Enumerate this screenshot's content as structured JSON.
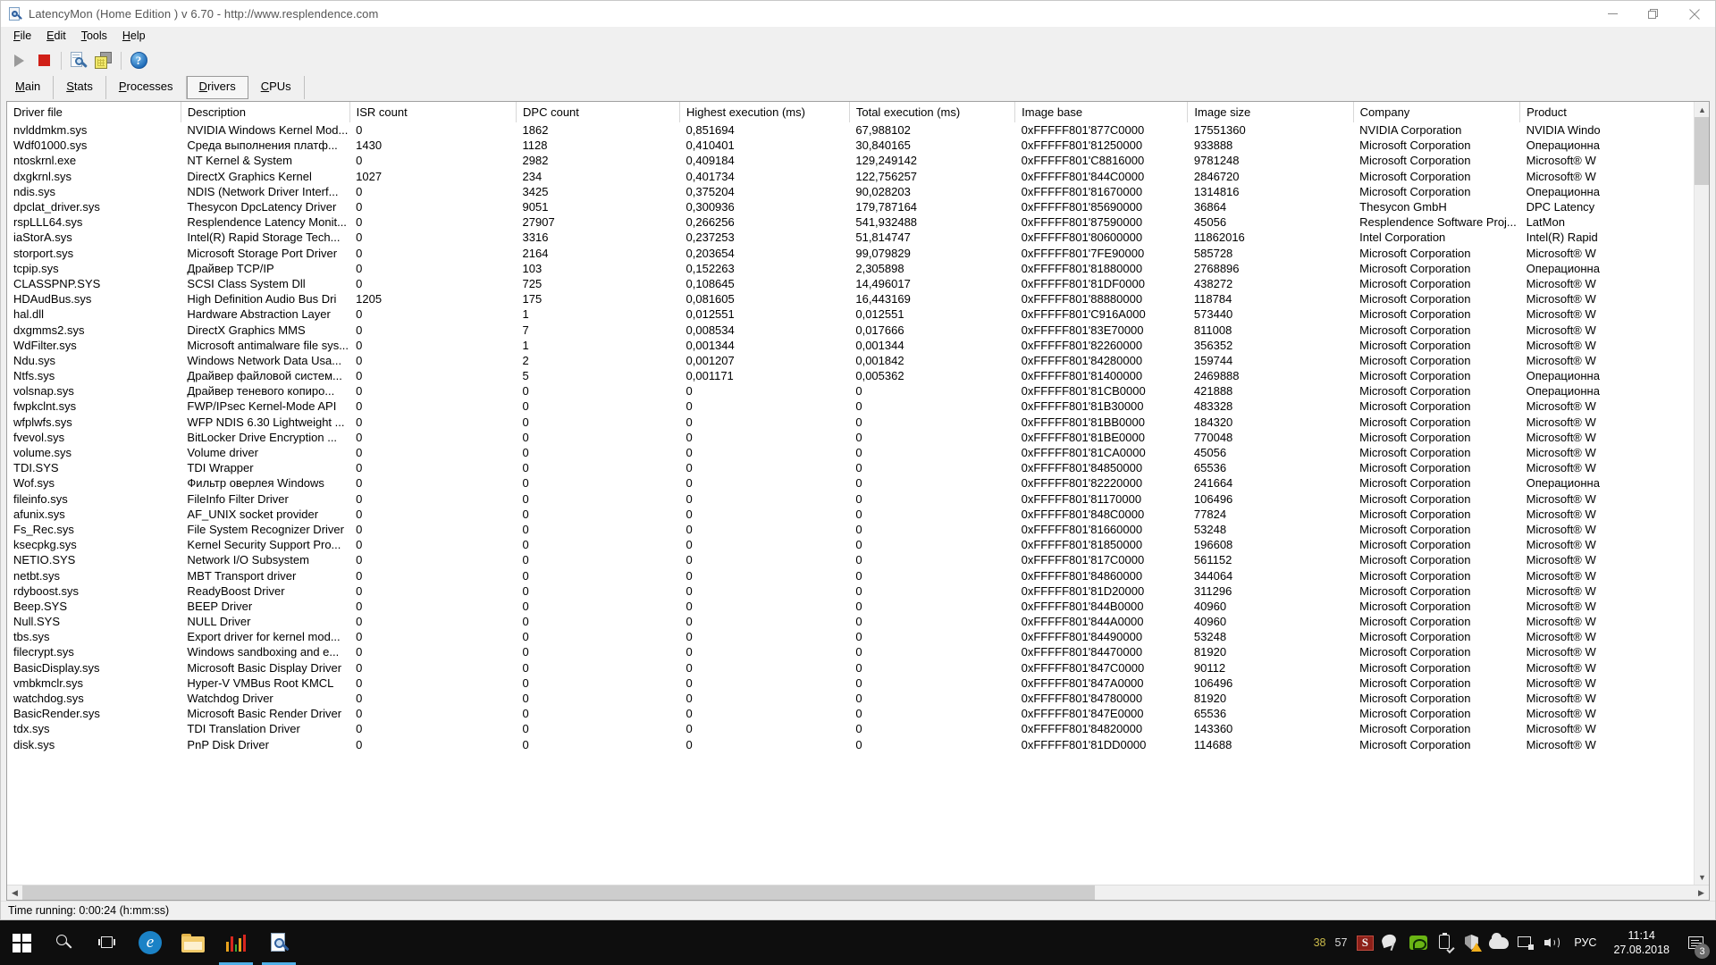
{
  "window": {
    "title": "LatencyMon  (Home Edition )  v 6.70 - http://www.resplendence.com",
    "icon": "latencymon-icon",
    "minimize": "minimize-icon",
    "maximize": "restore-icon",
    "close": "close-icon"
  },
  "menu": [
    {
      "label": "File",
      "accel": "F"
    },
    {
      "label": "Edit",
      "accel": "E"
    },
    {
      "label": "Tools",
      "accel": "T"
    },
    {
      "label": "Help",
      "accel": "H"
    }
  ],
  "toolbar": {
    "start_label": "start-monitoring",
    "stop_label": "stop-monitoring",
    "report_label": "view-report",
    "copy_label": "copy-to-clipboard",
    "help_label": "?"
  },
  "tabs": [
    {
      "label": "Main",
      "accel": "M",
      "active": false
    },
    {
      "label": "Stats",
      "accel": "S",
      "active": false
    },
    {
      "label": "Processes",
      "accel": "P",
      "active": false
    },
    {
      "label": "Drivers",
      "accel": "D",
      "active": true
    },
    {
      "label": "CPUs",
      "accel": "C",
      "active": false
    }
  ],
  "grid": {
    "columns": [
      "Driver file",
      "Description",
      "ISR count",
      "DPC count",
      "Highest execution (ms)",
      "Total execution (ms)",
      "Image base",
      "Image size",
      "Company",
      "Product"
    ],
    "rows": [
      [
        "nvlddmkm.sys",
        "NVIDIA Windows Kernel Mod...",
        "0",
        "1862",
        "0,851694",
        "67,988102",
        "0xFFFFF801'877C0000",
        "17551360",
        "NVIDIA Corporation",
        "NVIDIA Windo"
      ],
      [
        "Wdf01000.sys",
        "Среда выполнения платф...",
        "1430",
        "1128",
        "0,410401",
        "30,840165",
        "0xFFFFF801'81250000",
        "933888",
        "Microsoft Corporation",
        "Операционна"
      ],
      [
        "ntoskrnl.exe",
        "NT Kernel & System",
        "0",
        "2982",
        "0,409184",
        "129,249142",
        "0xFFFFF801'C8816000",
        "9781248",
        "Microsoft Corporation",
        "Microsoft® W"
      ],
      [
        "dxgkrnl.sys",
        "DirectX Graphics Kernel",
        "1027",
        "234",
        "0,401734",
        "122,756257",
        "0xFFFFF801'844C0000",
        "2846720",
        "Microsoft Corporation",
        "Microsoft® W"
      ],
      [
        "ndis.sys",
        "NDIS (Network Driver Interf...",
        "0",
        "3425",
        "0,375204",
        "90,028203",
        "0xFFFFF801'81670000",
        "1314816",
        "Microsoft Corporation",
        "Операционна"
      ],
      [
        "dpclat_driver.sys",
        "Thesycon DpcLatency Driver",
        "0",
        "9051",
        "0,300936",
        "179,787164",
        "0xFFFFF801'85690000",
        "36864",
        "Thesycon GmbH",
        "DPC Latency "
      ],
      [
        "rspLLL64.sys",
        "Resplendence Latency Monit...",
        "0",
        "27907",
        "0,266256",
        "541,932488",
        "0xFFFFF801'87590000",
        "45056",
        "Resplendence Software Proj...",
        "LatMon"
      ],
      [
        "iaStorA.sys",
        "Intel(R) Rapid Storage Tech...",
        "0",
        "3316",
        "0,237253",
        "51,814747",
        "0xFFFFF801'80600000",
        "11862016",
        "Intel Corporation",
        "Intel(R) Rapid"
      ],
      [
        "storport.sys",
        "Microsoft Storage Port Driver",
        "0",
        "2164",
        "0,203654",
        "99,079829",
        "0xFFFFF801'7FE90000",
        "585728",
        "Microsoft Corporation",
        "Microsoft® W"
      ],
      [
        "tcpip.sys",
        "Драйвер TCP/IP",
        "0",
        "103",
        "0,152263",
        "2,305898",
        "0xFFFFF801'81880000",
        "2768896",
        "Microsoft Corporation",
        "Операционна"
      ],
      [
        "CLASSPNP.SYS",
        "SCSI Class System Dll",
        "0",
        "725",
        "0,108645",
        "14,496017",
        "0xFFFFF801'81DF0000",
        "438272",
        "Microsoft Corporation",
        "Microsoft® W"
      ],
      [
        "HDAudBus.sys",
        "High Definition Audio Bus Dri",
        "1205",
        "175",
        "0,081605",
        "16,443169",
        "0xFFFFF801'88880000",
        "118784",
        "Microsoft Corporation",
        "Microsoft® W"
      ],
      [
        "hal.dll",
        "Hardware Abstraction Layer",
        "0",
        "1",
        "0,012551",
        "0,012551",
        "0xFFFFF801'C916A000",
        "573440",
        "Microsoft Corporation",
        "Microsoft® W"
      ],
      [
        "dxgmms2.sys",
        "DirectX Graphics MMS",
        "0",
        "7",
        "0,008534",
        "0,017666",
        "0xFFFFF801'83E70000",
        "811008",
        "Microsoft Corporation",
        "Microsoft® W"
      ],
      [
        "WdFilter.sys",
        "Microsoft antimalware file sys...",
        "0",
        "1",
        "0,001344",
        "0,001344",
        "0xFFFFF801'82260000",
        "356352",
        "Microsoft Corporation",
        "Microsoft® W"
      ],
      [
        "Ndu.sys",
        "Windows Network Data Usa...",
        "0",
        "2",
        "0,001207",
        "0,001842",
        "0xFFFFF801'84280000",
        "159744",
        "Microsoft Corporation",
        "Microsoft® W"
      ],
      [
        "Ntfs.sys",
        "Драйвер файловой систем...",
        "0",
        "5",
        "0,001171",
        "0,005362",
        "0xFFFFF801'81400000",
        "2469888",
        "Microsoft Corporation",
        "Операционна"
      ],
      [
        "volsnap.sys",
        "Драйвер теневого копиро...",
        "0",
        "0",
        "0",
        "0",
        "0xFFFFF801'81CB0000",
        "421888",
        "Microsoft Corporation",
        "Операционна"
      ],
      [
        "fwpkclnt.sys",
        "FWP/IPsec Kernel-Mode API",
        "0",
        "0",
        "0",
        "0",
        "0xFFFFF801'81B30000",
        "483328",
        "Microsoft Corporation",
        "Microsoft® W"
      ],
      [
        "wfplwfs.sys",
        "WFP NDIS 6.30 Lightweight ...",
        "0",
        "0",
        "0",
        "0",
        "0xFFFFF801'81BB0000",
        "184320",
        "Microsoft Corporation",
        "Microsoft® W"
      ],
      [
        "fvevol.sys",
        "BitLocker Drive Encryption ...",
        "0",
        "0",
        "0",
        "0",
        "0xFFFFF801'81BE0000",
        "770048",
        "Microsoft Corporation",
        "Microsoft® W"
      ],
      [
        "volume.sys",
        "Volume driver",
        "0",
        "0",
        "0",
        "0",
        "0xFFFFF801'81CA0000",
        "45056",
        "Microsoft Corporation",
        "Microsoft® W"
      ],
      [
        "TDI.SYS",
        "TDI Wrapper",
        "0",
        "0",
        "0",
        "0",
        "0xFFFFF801'84850000",
        "65536",
        "Microsoft Corporation",
        "Microsoft® W"
      ],
      [
        "Wof.sys",
        "Фильтр оверлея Windows",
        "0",
        "0",
        "0",
        "0",
        "0xFFFFF801'82220000",
        "241664",
        "Microsoft Corporation",
        "Операционна"
      ],
      [
        "fileinfo.sys",
        "FileInfo Filter Driver",
        "0",
        "0",
        "0",
        "0",
        "0xFFFFF801'81170000",
        "106496",
        "Microsoft Corporation",
        "Microsoft® W"
      ],
      [
        "afunix.sys",
        "AF_UNIX socket provider",
        "0",
        "0",
        "0",
        "0",
        "0xFFFFF801'848C0000",
        "77824",
        "Microsoft Corporation",
        "Microsoft® W"
      ],
      [
        "Fs_Rec.sys",
        "File System Recognizer Driver",
        "0",
        "0",
        "0",
        "0",
        "0xFFFFF801'81660000",
        "53248",
        "Microsoft Corporation",
        "Microsoft® W"
      ],
      [
        "ksecpkg.sys",
        "Kernel Security Support Pro...",
        "0",
        "0",
        "0",
        "0",
        "0xFFFFF801'81850000",
        "196608",
        "Microsoft Corporation",
        "Microsoft® W"
      ],
      [
        "NETIO.SYS",
        "Network I/O Subsystem",
        "0",
        "0",
        "0",
        "0",
        "0xFFFFF801'817C0000",
        "561152",
        "Microsoft Corporation",
        "Microsoft® W"
      ],
      [
        "netbt.sys",
        "MBT Transport driver",
        "0",
        "0",
        "0",
        "0",
        "0xFFFFF801'84860000",
        "344064",
        "Microsoft Corporation",
        "Microsoft® W"
      ],
      [
        "rdyboost.sys",
        "ReadyBoost Driver",
        "0",
        "0",
        "0",
        "0",
        "0xFFFFF801'81D20000",
        "311296",
        "Microsoft Corporation",
        "Microsoft® W"
      ],
      [
        "Beep.SYS",
        "BEEP Driver",
        "0",
        "0",
        "0",
        "0",
        "0xFFFFF801'844B0000",
        "40960",
        "Microsoft Corporation",
        "Microsoft® W"
      ],
      [
        "Null.SYS",
        "NULL Driver",
        "0",
        "0",
        "0",
        "0",
        "0xFFFFF801'844A0000",
        "40960",
        "Microsoft Corporation",
        "Microsoft® W"
      ],
      [
        "tbs.sys",
        "Export driver for kernel mod...",
        "0",
        "0",
        "0",
        "0",
        "0xFFFFF801'84490000",
        "53248",
        "Microsoft Corporation",
        "Microsoft® W"
      ],
      [
        "filecrypt.sys",
        "Windows sandboxing and e...",
        "0",
        "0",
        "0",
        "0",
        "0xFFFFF801'84470000",
        "81920",
        "Microsoft Corporation",
        "Microsoft® W"
      ],
      [
        "BasicDisplay.sys",
        "Microsoft Basic Display Driver",
        "0",
        "0",
        "0",
        "0",
        "0xFFFFF801'847C0000",
        "90112",
        "Microsoft Corporation",
        "Microsoft® W"
      ],
      [
        "vmbkmclr.sys",
        "Hyper-V VMBus Root KMCL",
        "0",
        "0",
        "0",
        "0",
        "0xFFFFF801'847A0000",
        "106496",
        "Microsoft Corporation",
        "Microsoft® W"
      ],
      [
        "watchdog.sys",
        "Watchdog Driver",
        "0",
        "0",
        "0",
        "0",
        "0xFFFFF801'84780000",
        "81920",
        "Microsoft Corporation",
        "Microsoft® W"
      ],
      [
        "BasicRender.sys",
        "Microsoft Basic Render Driver",
        "0",
        "0",
        "0",
        "0",
        "0xFFFFF801'847E0000",
        "65536",
        "Microsoft Corporation",
        "Microsoft® W"
      ],
      [
        "tdx.sys",
        "TDI Translation Driver",
        "0",
        "0",
        "0",
        "0",
        "0xFFFFF801'84820000",
        "143360",
        "Microsoft Corporation",
        "Microsoft® W"
      ],
      [
        "disk.sys",
        "PnP Disk Driver",
        "0",
        "0",
        "0",
        "0",
        "0xFFFFF801'81DD0000",
        "114688",
        "Microsoft Corporation",
        "Microsoft® W"
      ]
    ]
  },
  "statusbar": {
    "text": "Time running: 0:00:24  (h:mm:ss)"
  },
  "taskbar": {
    "start": "windows-start-icon",
    "search": "search-icon",
    "taskview": "task-view-icon",
    "edge": "e",
    "explorer": "file-explorer-icon",
    "chart_app": "performance-chart-icon",
    "latencymon": "latencymon-taskbar-icon",
    "tray": {
      "num1": "38",
      "num2": "57",
      "lang": "РУС",
      "time": "11:14",
      "date": "27.08.2018",
      "notification_count": "3"
    }
  }
}
